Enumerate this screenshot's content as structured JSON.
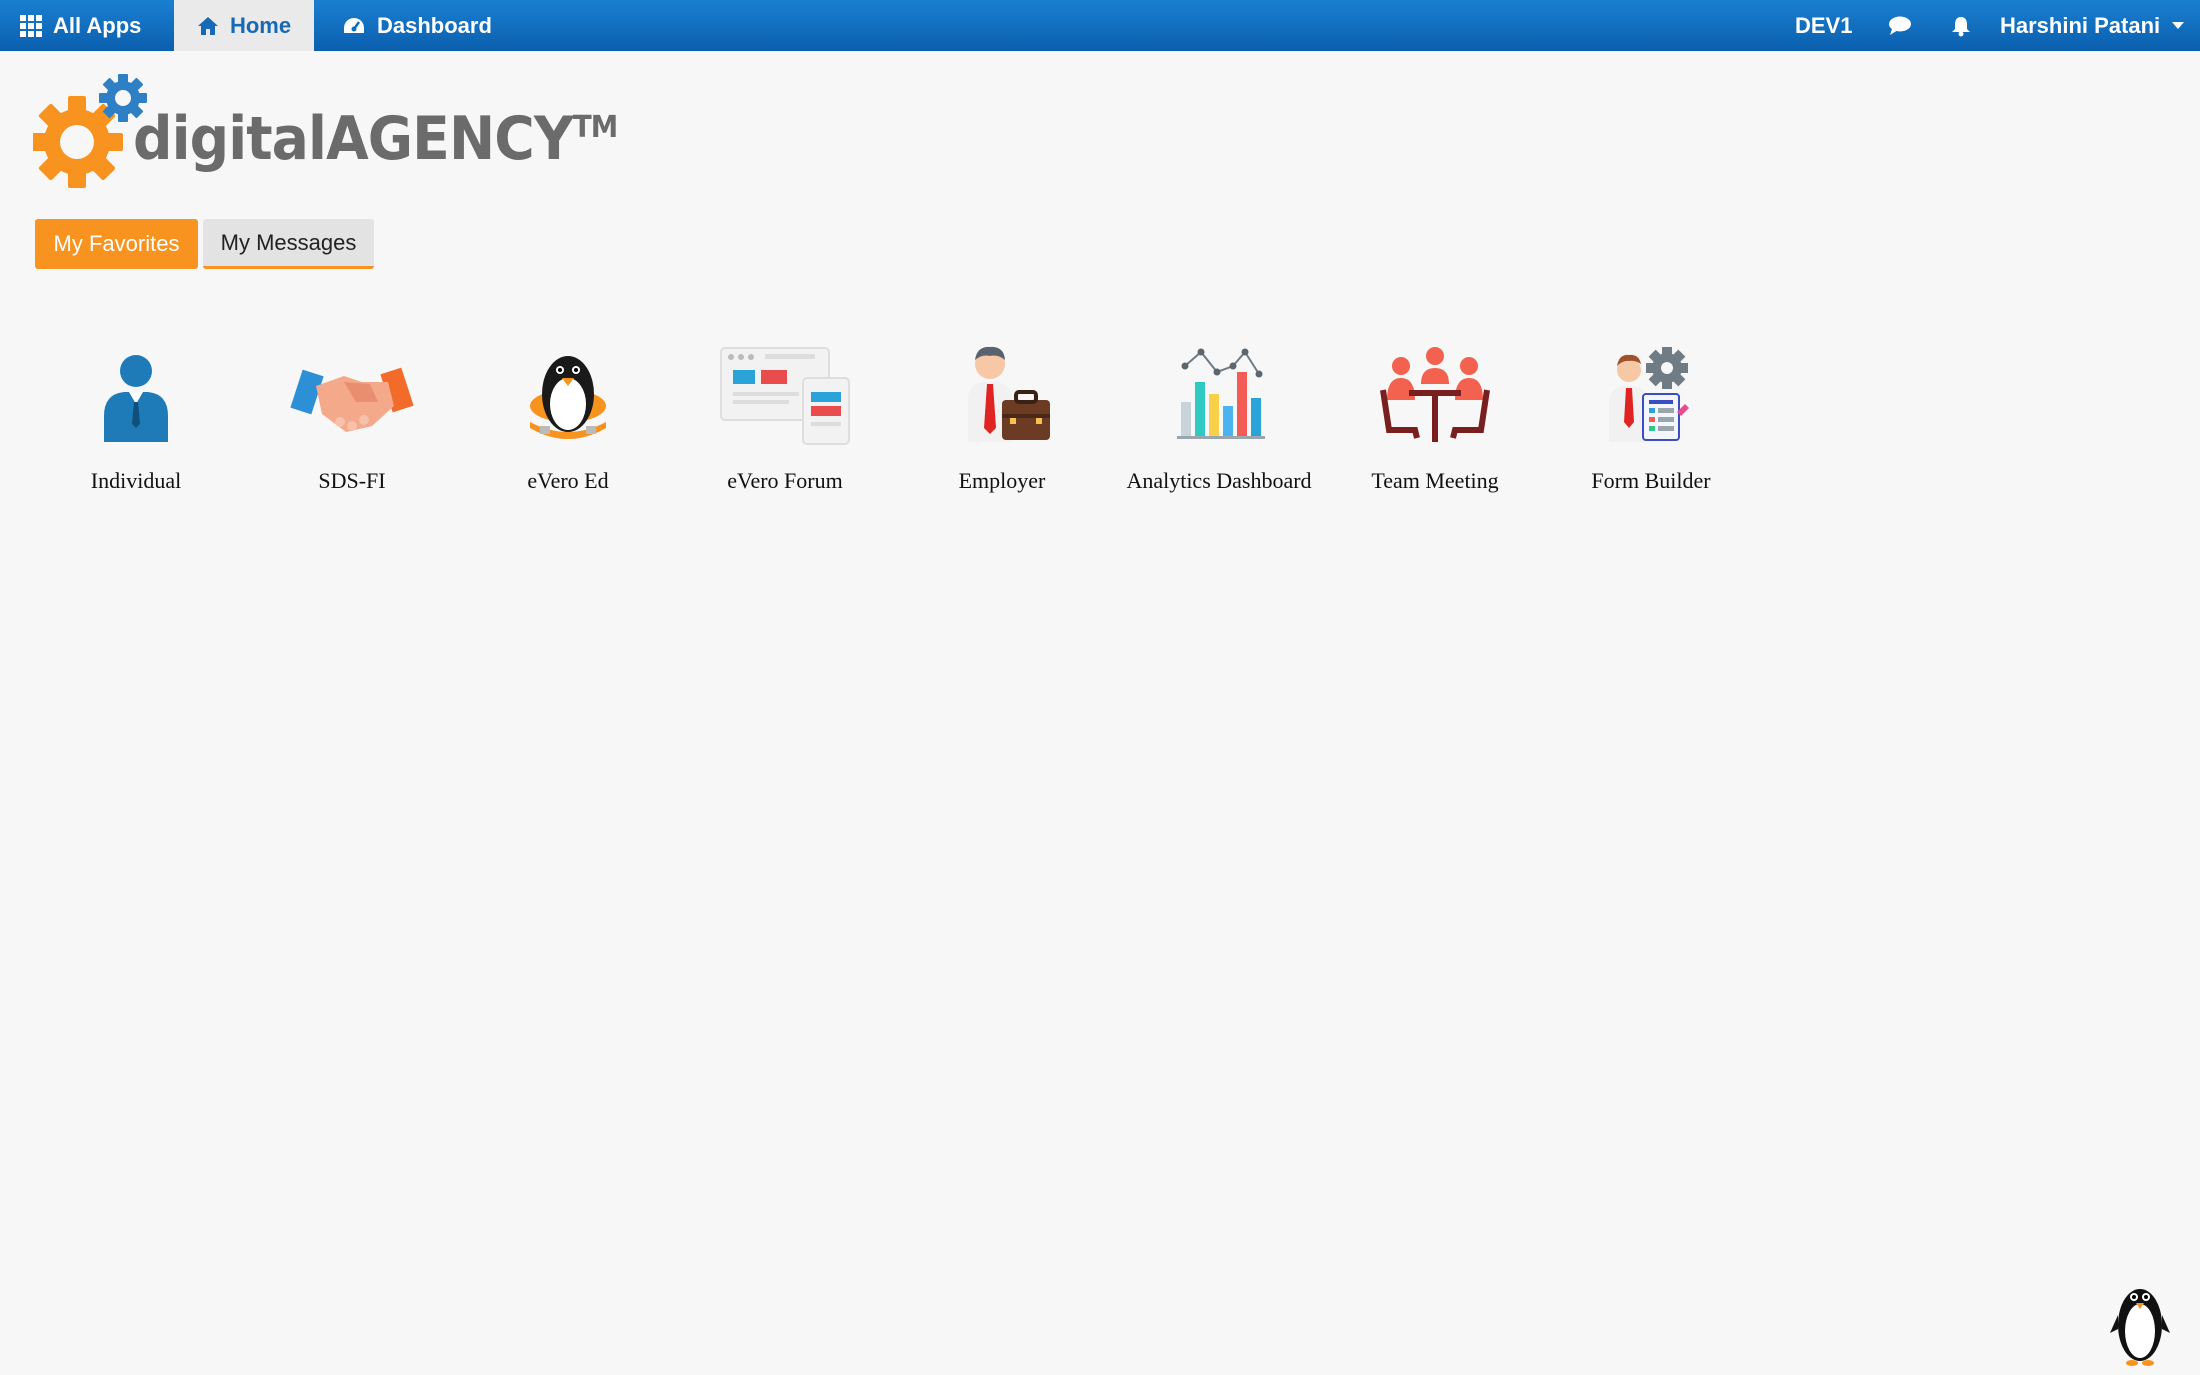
{
  "topbar": {
    "all_apps": "All Apps",
    "home": "Home",
    "dashboard": "Dashboard",
    "env": "DEV1",
    "user": "Harshini Patani",
    "icons": [
      "grid-icon",
      "home-icon",
      "dashboard-gauge-icon",
      "chat-icon",
      "bell-icon",
      "caret-down-icon"
    ]
  },
  "logo": {
    "text": "digitalAGENCY",
    "tm": "TM"
  },
  "tabs": {
    "favorites": "My Favorites",
    "messages": "My Messages"
  },
  "apps": [
    {
      "label": "Individual",
      "icon": "individual-icon"
    },
    {
      "label": "SDS-FI",
      "icon": "handshake-icon"
    },
    {
      "label": "eVero Ed",
      "icon": "penguin-icon"
    },
    {
      "label": "eVero Forum",
      "icon": "forum-icon"
    },
    {
      "label": "Employer",
      "icon": "employer-icon"
    },
    {
      "label": "Analytics Dashboard",
      "icon": "analytics-chart-icon"
    },
    {
      "label": "Team Meeting",
      "icon": "team-meeting-icon"
    },
    {
      "label": "Form Builder",
      "icon": "form-builder-icon"
    }
  ],
  "colors": {
    "topbar": "#0b6fc2",
    "active_tab": "#f7931e",
    "logo_orange": "#f7931e",
    "logo_blue": "#2f7fc4"
  }
}
